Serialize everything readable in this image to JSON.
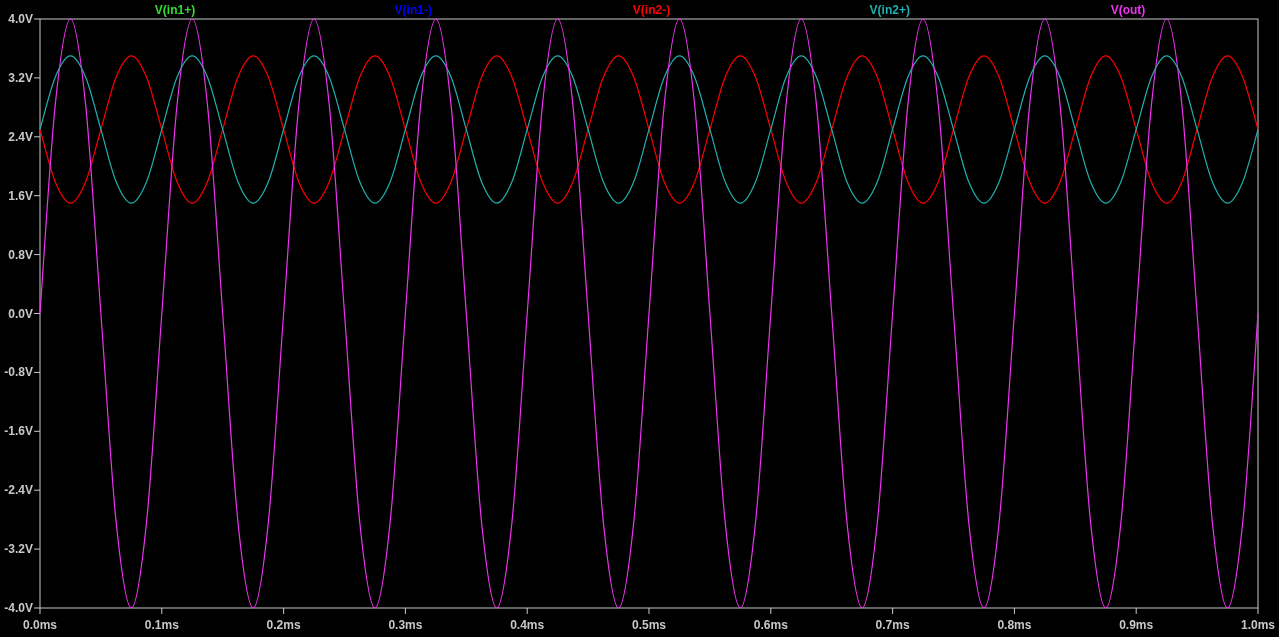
{
  "plot": {
    "chart_data": {
      "type": "line",
      "x": [
        0,
        0.0125,
        0.025,
        0.0375,
        0.05,
        0.0625,
        0.075,
        0.0875,
        0.1,
        0.1125,
        0.125,
        0.1375,
        0.15,
        0.1625,
        0.175,
        0.1875,
        0.2,
        0.2125,
        0.225,
        0.2375,
        0.25,
        0.2625,
        0.275,
        0.2875,
        0.3,
        0.3125,
        0.325,
        0.3375,
        0.35,
        0.3625,
        0.375,
        0.3875,
        0.4,
        0.4125,
        0.425,
        0.4375,
        0.45,
        0.4625,
        0.475,
        0.4875,
        0.5,
        0.5125,
        0.525,
        0.5375,
        0.55,
        0.5625,
        0.575,
        0.5875,
        0.6,
        0.6125,
        0.625,
        0.6375,
        0.65,
        0.6625,
        0.675,
        0.6875,
        0.7,
        0.7125,
        0.725,
        0.7375,
        0.75,
        0.7625,
        0.775,
        0.7875,
        0.8,
        0.8125,
        0.825,
        0.8375,
        0.85,
        0.8625,
        0.875,
        0.8875,
        0.9,
        0.9125,
        0.925,
        0.9375,
        0.95,
        0.9625,
        0.975,
        0.9875,
        1.0
      ],
      "series": [
        {
          "name": "V(in1+)",
          "color": "#33dd33",
          "values": [
            null,
            null,
            null,
            null,
            null,
            null,
            null,
            null,
            null,
            null,
            null,
            null,
            null,
            null,
            null,
            null,
            null,
            null,
            null,
            null,
            null,
            null,
            null,
            null,
            null,
            null,
            null,
            null,
            null,
            null,
            null,
            null,
            null,
            null,
            null,
            null,
            null,
            null,
            null,
            null,
            null,
            null,
            null,
            null,
            null,
            null,
            null,
            null,
            null,
            null,
            null,
            null,
            null,
            null,
            null,
            null,
            null,
            null,
            null,
            null,
            null,
            null,
            null,
            null,
            null,
            null,
            null,
            null,
            null,
            null,
            null,
            null,
            null,
            null,
            null,
            null,
            null,
            null,
            null,
            null,
            null
          ]
        },
        {
          "name": "V(in1-)",
          "color": "#0000ff",
          "values": [
            null,
            null,
            null,
            null,
            null,
            null,
            null,
            null,
            null,
            null,
            null,
            null,
            null,
            null,
            null,
            null,
            null,
            null,
            null,
            null,
            null,
            null,
            null,
            null,
            null,
            null,
            null,
            null,
            null,
            null,
            null,
            null,
            null,
            null,
            null,
            null,
            null,
            null,
            null,
            null,
            null,
            null,
            null,
            null,
            null,
            null,
            null,
            null,
            null,
            null,
            null,
            null,
            null,
            null,
            null,
            null,
            null,
            null,
            null,
            null,
            null,
            null,
            null,
            null,
            null,
            null,
            null,
            null,
            null,
            null,
            null,
            null,
            null,
            null,
            null,
            null,
            null,
            null,
            null,
            null,
            null
          ]
        },
        {
          "name": "V(in2-)",
          "color": "#ff0000",
          "values": [
            2.5,
            1.79,
            1.5,
            1.79,
            2.5,
            3.21,
            3.5,
            3.21,
            2.5,
            1.79,
            1.5,
            1.79,
            2.5,
            3.21,
            3.5,
            3.21,
            2.5,
            1.79,
            1.5,
            1.79,
            2.5,
            3.21,
            3.5,
            3.21,
            2.5,
            1.79,
            1.5,
            1.79,
            2.5,
            3.21,
            3.5,
            3.21,
            2.5,
            1.79,
            1.5,
            1.79,
            2.5,
            3.21,
            3.5,
            3.21,
            2.5,
            1.79,
            1.5,
            1.79,
            2.5,
            3.21,
            3.5,
            3.21,
            2.5,
            1.79,
            1.5,
            1.79,
            2.5,
            3.21,
            3.5,
            3.21,
            2.5,
            1.79,
            1.5,
            1.79,
            2.5,
            3.21,
            3.5,
            3.21,
            2.5,
            1.79,
            1.5,
            1.79,
            2.5,
            3.21,
            3.5,
            3.21,
            2.5,
            1.79,
            1.5,
            1.79,
            2.5,
            3.21,
            3.5,
            3.21,
            2.5
          ]
        },
        {
          "name": "V(in2+)",
          "color": "#22b0b0",
          "values": [
            2.5,
            3.21,
            3.5,
            3.21,
            2.5,
            1.79,
            1.5,
            1.79,
            2.5,
            3.21,
            3.5,
            3.21,
            2.5,
            1.79,
            1.5,
            1.79,
            2.5,
            3.21,
            3.5,
            3.21,
            2.5,
            1.79,
            1.5,
            1.79,
            2.5,
            3.21,
            3.5,
            3.21,
            2.5,
            1.79,
            1.5,
            1.79,
            2.5,
            3.21,
            3.5,
            3.21,
            2.5,
            1.79,
            1.5,
            1.79,
            2.5,
            3.21,
            3.5,
            3.21,
            2.5,
            1.79,
            1.5,
            1.79,
            2.5,
            3.21,
            3.5,
            3.21,
            2.5,
            1.79,
            1.5,
            1.79,
            2.5,
            3.21,
            3.5,
            3.21,
            2.5,
            1.79,
            1.5,
            1.79,
            2.5,
            3.21,
            3.5,
            3.21,
            2.5,
            1.79,
            1.5,
            1.79,
            2.5,
            3.21,
            3.5,
            3.21,
            2.5,
            1.79,
            1.5,
            1.79,
            2.5
          ]
        },
        {
          "name": "V(out)",
          "color": "#ee33ee",
          "values": [
            0,
            2.83,
            4,
            2.83,
            0,
            -2.83,
            -4,
            -2.83,
            0,
            2.83,
            4,
            2.83,
            0,
            -2.83,
            -4,
            -2.83,
            0,
            2.83,
            4,
            2.83,
            0,
            -2.83,
            -4,
            -2.83,
            0,
            2.83,
            4,
            2.83,
            0,
            -2.83,
            -4,
            -2.83,
            0,
            2.83,
            4,
            2.83,
            0,
            -2.83,
            -4,
            -2.83,
            0,
            2.83,
            4,
            2.83,
            0,
            -2.83,
            -4,
            -2.83,
            0,
            2.83,
            4,
            2.83,
            0,
            -2.83,
            -4,
            -2.83,
            0,
            2.83,
            4,
            2.83,
            0,
            -2.83,
            -4,
            -2.83,
            0,
            2.83,
            4,
            2.83,
            0,
            -2.83,
            -4,
            -2.83,
            0,
            2.83,
            4,
            2.83,
            0,
            -2.83,
            -4,
            -2.83,
            0
          ]
        }
      ],
      "xlim": [
        0,
        1
      ],
      "ylim": [
        -4,
        4
      ],
      "xticks": [
        {
          "value": 0,
          "label": "0.0ms"
        },
        {
          "value": 0.1,
          "label": "0.1ms"
        },
        {
          "value": 0.2,
          "label": "0.2ms"
        },
        {
          "value": 0.3,
          "label": "0.3ms"
        },
        {
          "value": 0.4,
          "label": "0.4ms"
        },
        {
          "value": 0.5,
          "label": "0.5ms"
        },
        {
          "value": 0.6,
          "label": "0.6ms"
        },
        {
          "value": 0.7,
          "label": "0.7ms"
        },
        {
          "value": 0.8,
          "label": "0.8ms"
        },
        {
          "value": 0.9,
          "label": "0.9ms"
        },
        {
          "value": 1,
          "label": "1.0ms"
        }
      ],
      "yticks": [
        {
          "value": 4,
          "label": "4.0V"
        },
        {
          "value": 3.2,
          "label": "3.2V"
        },
        {
          "value": 2.4,
          "label": "2.4V"
        },
        {
          "value": 1.6,
          "label": "1.6V"
        },
        {
          "value": 0.8,
          "label": "0.8V"
        },
        {
          "value": 0,
          "label": "0.0V"
        },
        {
          "value": -0.8,
          "label": "-0.8V"
        },
        {
          "value": -1.6,
          "label": "-1.6V"
        },
        {
          "value": -2.4,
          "label": "-2.4V"
        },
        {
          "value": -3.2,
          "label": "-3.2V"
        },
        {
          "value": -4,
          "label": "-4.0V"
        }
      ]
    }
  }
}
